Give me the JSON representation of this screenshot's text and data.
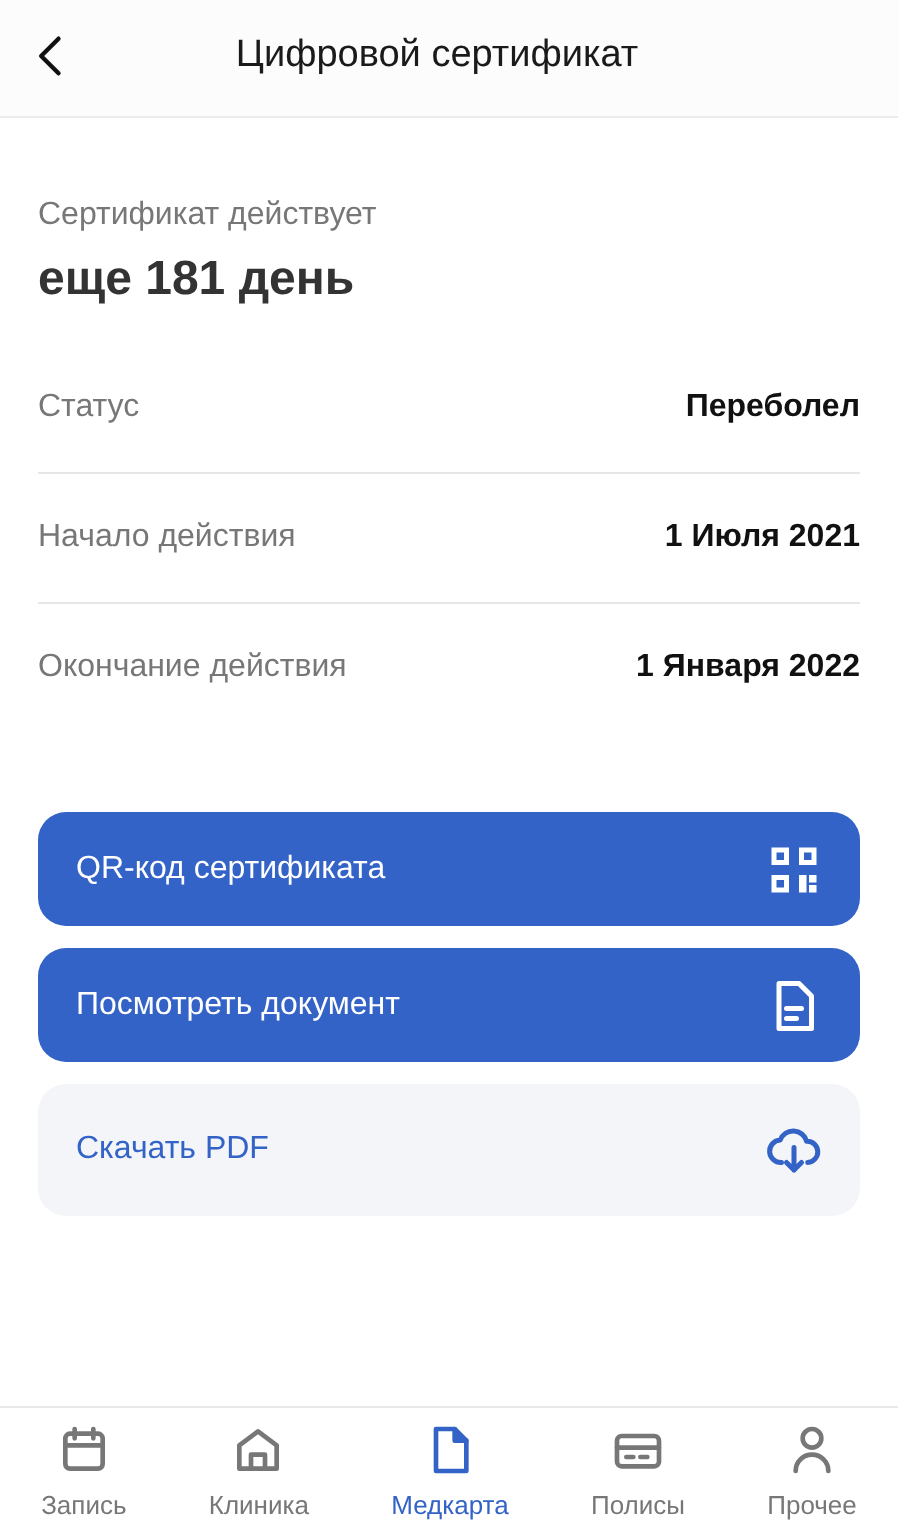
{
  "header": {
    "title": "Цифровой сертификат"
  },
  "validity": {
    "label": "Сертификат действует",
    "value": "еще 181 день"
  },
  "rows": [
    {
      "label": "Статус",
      "value": "Переболел"
    },
    {
      "label": "Начало действия",
      "value": "1 Июля 2021"
    },
    {
      "label": "Окончание действия",
      "value": "1 Января 2022"
    }
  ],
  "actions": [
    {
      "label": "QR-код сертификата",
      "kind": "primary"
    },
    {
      "label": "Посмотреть документ",
      "kind": "primary"
    },
    {
      "label": "Скачать PDF",
      "kind": "secondary"
    }
  ],
  "tab_bar": [
    {
      "label": "Запись",
      "kind": "calendar",
      "selected": false
    },
    {
      "label": "Клиника",
      "kind": "home",
      "selected": false
    },
    {
      "label": "Медкарта",
      "kind": "file",
      "selected": true
    },
    {
      "label": "Полисы",
      "kind": "card",
      "selected": false
    },
    {
      "label": "Прочее",
      "kind": "person",
      "selected": false
    }
  ]
}
